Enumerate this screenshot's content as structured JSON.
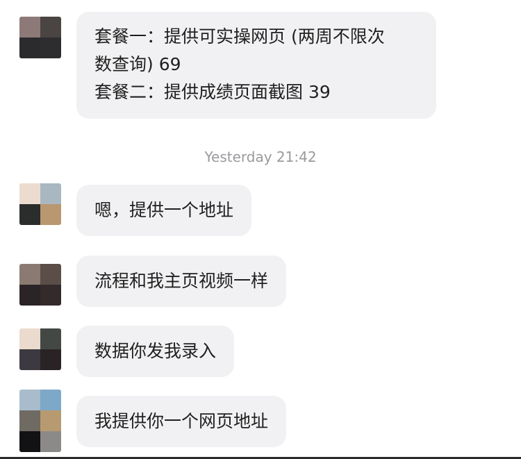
{
  "timestamp": "Yesterday 21:42",
  "messages": [
    {
      "lines": [
        "套餐一：提供可实操网页 (两周不限次",
        "数查询) 69",
        "套餐二：提供成绩页面截图 39"
      ],
      "avatar_colors": [
        "#8d7a78",
        "#4a4542",
        "#2b2b2e",
        "#2d2c2f"
      ]
    },
    {
      "lines": [
        "嗯，提供一个地址"
      ],
      "avatar_colors": [
        "#ecdcd0",
        "#a9b8c0",
        "#2b2d2c",
        "#b9976f"
      ]
    },
    {
      "lines": [
        "流程和我主页视频一样"
      ],
      "avatar_colors": [
        "#8a7a72",
        "#5b4d48",
        "#2a2426",
        "#332a2c"
      ]
    },
    {
      "lines": [
        "数据你发我录入"
      ],
      "avatar_colors": [
        "#eadbce",
        "#444845",
        "#3c3a40",
        "#2a2326"
      ]
    },
    {
      "lines": [
        "我提供你一个网页地址"
      ],
      "avatar_colors": [
        "#a8bccb",
        "#7ea8c8",
        "#6f6a62",
        "#b89a70",
        "#121214",
        "#8c8a88"
      ]
    }
  ],
  "colors": {
    "bubble_bg": "#f1f1f3",
    "text": "#1f1f1f",
    "timestamp": "#9a9a9e"
  }
}
